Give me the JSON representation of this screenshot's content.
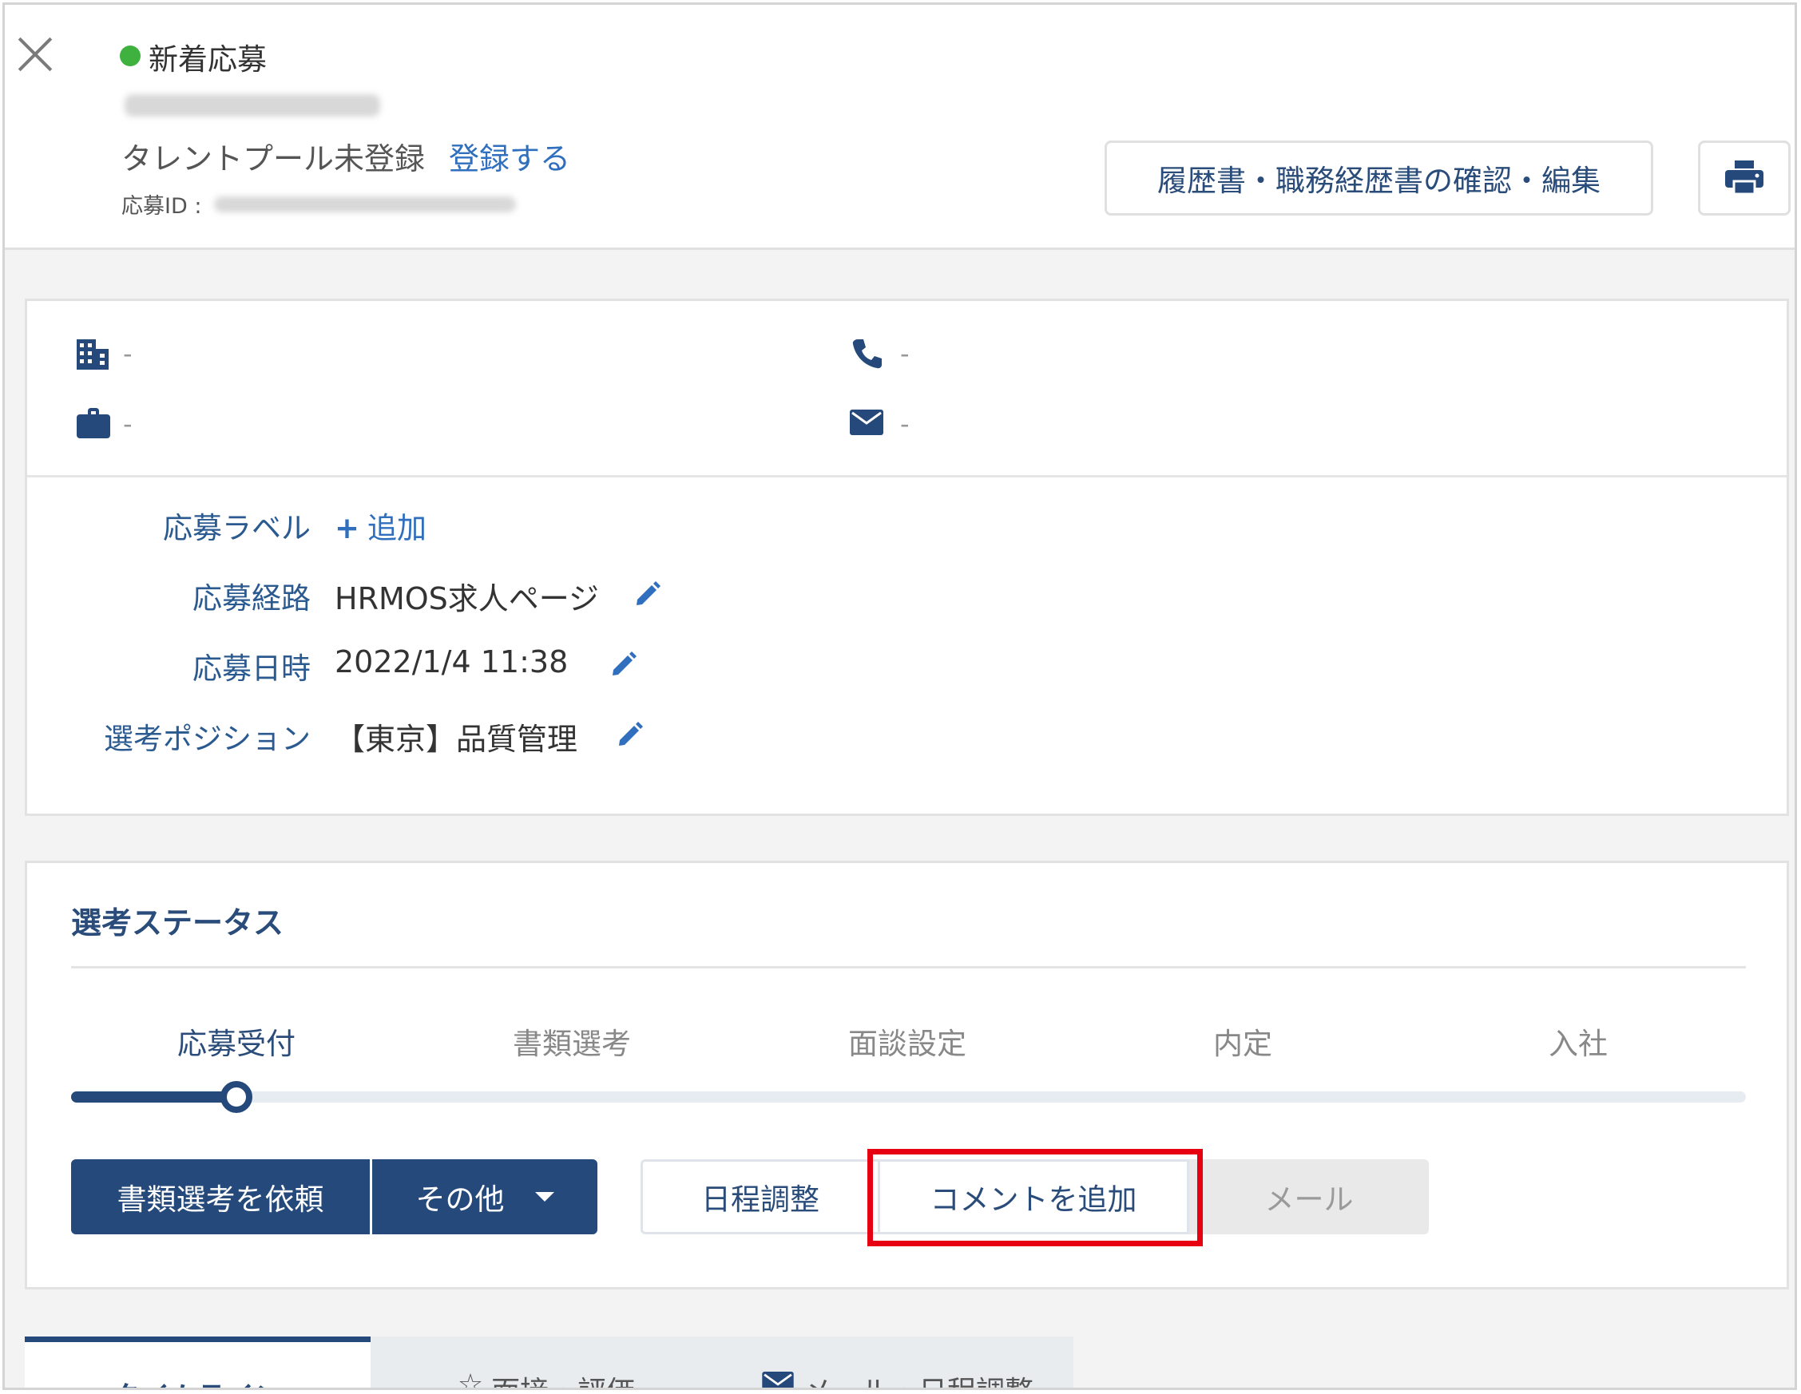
{
  "header": {
    "status_label": "新着応募",
    "status_color": "#3fb13f",
    "talent_pool_status": "タレントプール未登録",
    "register_link": "登録する",
    "application_id_label": "応募ID :",
    "resume_button": "履歴書・職務経歴書の確認・編集",
    "print_icon": "printer-icon",
    "close_icon": "close-icon"
  },
  "contact": {
    "company": "-",
    "phone": "-",
    "job": "-",
    "email": "-"
  },
  "fields": {
    "label_label": "応募ラベル",
    "label_add": "追加",
    "route_label": "応募経路",
    "route_value": "HRMOS求人ページ",
    "date_label": "応募日時",
    "date_value": "2022/1/4 11:38",
    "position_label": "選考ポジション",
    "position_value": "【東京】品質管理"
  },
  "selection": {
    "title": "選考ステータス",
    "steps": [
      "応募受付",
      "書類選考",
      "面談設定",
      "内定",
      "入社"
    ],
    "current_step": 0,
    "primary_button": "書類選考を依頼",
    "other_button": "その他",
    "schedule_button": "日程調整",
    "comment_button": "コメントを追加",
    "mail_button": "メール"
  },
  "tabs": [
    "タイムライン",
    "面接・評価",
    "メール・日程調整"
  ],
  "colors": {
    "primary": "#24497a",
    "link": "#2f6fbd",
    "highlight": "#e60012"
  }
}
